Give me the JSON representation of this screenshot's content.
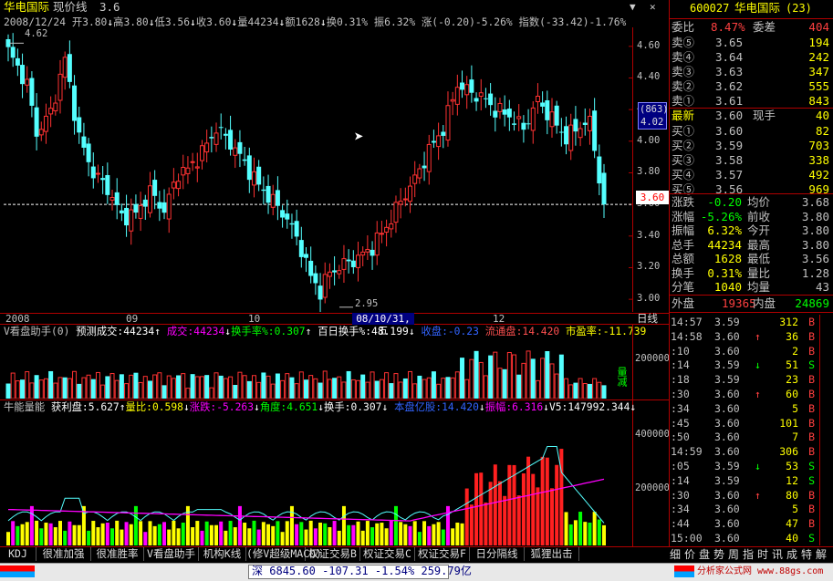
{
  "header": {
    "name": "华电国际",
    "label": "现价线",
    "price": "3.6"
  },
  "quote_line": {
    "date": "2008/12/24",
    "open_label": "开",
    "open": "3.80",
    "high_label": "高",
    "high": "3.80",
    "low_label": "低",
    "low": "3.56",
    "close_label": "收",
    "close": "3.60",
    "vol_label": "量",
    "vol": "44234",
    "amt_label": "额",
    "amt": "1628",
    "turn_label": "换",
    "turn": "0.31%",
    "amp_label": "振",
    "amp": "6.32%",
    "chg_label": "涨",
    "chg": "(-0.20)-5.26%",
    "idx_label": "指数",
    "idx": "(-33.42)-1.76%"
  },
  "main_chart": {
    "type": "candlestick",
    "y_ticks": [
      "4.60",
      "4.40",
      "4.20",
      "4.00",
      "3.80",
      "3.60",
      "3.40",
      "3.20",
      "3.00"
    ],
    "y_range": [
      2.92,
      4.72
    ],
    "current_price": "3.60",
    "crosshair": {
      "top": "(863)",
      "bottom": "4.02"
    },
    "max_label": "4.62",
    "min_label": "2.95",
    "colors": {
      "up": "#ff3232",
      "down": "#54ffff",
      "axis": "#b00000",
      "text": "#c0c0c0"
    }
  },
  "date_axis": {
    "labels": [
      "2008",
      "09",
      "10",
      "12"
    ],
    "highlight": "08/10/31,五",
    "right_label": "日线"
  },
  "vol_panel": {
    "title": "V看盘助手(0)",
    "f1_label": "预测成交:",
    "f1": "44234",
    "f2_label": "成交:",
    "f2": "44234",
    "f3_label": "换手率%:",
    "f3": "0.307",
    "f4_label": "百日换手%:",
    "f4": "48.199",
    "f5_label": "收盘:",
    "f5": "-0.23",
    "f6_label": "流通盘:",
    "f6": "14.420",
    "f7_label": "市盈率:",
    "f7": "-11.739",
    "y_ticks": [
      "200000"
    ],
    "side_label": "量减"
  },
  "energy_panel": {
    "title": "牛能量能",
    "f1_label": "获利盘:",
    "f1": "5.627",
    "f2_label": "量比:",
    "f2": "0.598",
    "f3_label": "涨跌:",
    "f3": "-5.263",
    "f4_label": "角度:",
    "f4": "4.651",
    "f5_label": "换手:",
    "f5": "0.307",
    "f6_label": "本盘亿股:",
    "f6": "14.420",
    "f7_label": "振幅:",
    "f7": "6.316",
    "f8_label": "V5:",
    "f8": "147992.344",
    "y_ticks": [
      "400000",
      "200000"
    ]
  },
  "tabs": [
    "KDJ",
    "很准加强",
    "很准胜率",
    "V看盘助手",
    "机构K线",
    "(修V超级MACD)",
    "权证交易B",
    "权证交易C",
    "权证交易F",
    "日分隔线",
    "狐狸出击"
  ],
  "status_bar": {
    "index_name": "深",
    "index_value": "6845.60",
    "change": "-107.31",
    "pct": "-1.54%",
    "amount": "259.79亿",
    "watermark": "分析家公式网 www.88gs.com"
  },
  "right_panel": {
    "code": "600027",
    "name": "华电国际",
    "num": "(23)",
    "weibi_label": "委比",
    "weibi": "8.47%",
    "weicha_label": "委差",
    "weicha": "404",
    "sells": [
      {
        "label": "卖⑤",
        "price": "3.65",
        "vol": "194"
      },
      {
        "label": "卖④",
        "price": "3.64",
        "vol": "242"
      },
      {
        "label": "卖③",
        "price": "3.63",
        "vol": "347"
      },
      {
        "label": "卖②",
        "price": "3.62",
        "vol": "555"
      },
      {
        "label": "卖①",
        "price": "3.61",
        "vol": "843"
      }
    ],
    "last_label": "最新",
    "last": "3.60",
    "xianshou_label": "现手",
    "xianshou": "40",
    "buys": [
      {
        "label": "买①",
        "price": "3.60",
        "vol": "82"
      },
      {
        "label": "买②",
        "price": "3.59",
        "vol": "703"
      },
      {
        "label": "买③",
        "price": "3.58",
        "vol": "338"
      },
      {
        "label": "买④",
        "price": "3.57",
        "vol": "492"
      },
      {
        "label": "买⑤",
        "price": "3.56",
        "vol": "969"
      }
    ],
    "stats": [
      {
        "l1": "涨跌",
        "v1": "-0.20",
        "l2": "均价",
        "v2": "3.68"
      },
      {
        "l1": "涨幅",
        "v1": "-5.26%",
        "l2": "前收",
        "v2": "3.80"
      },
      {
        "l1": "振幅",
        "v1": "6.32%",
        "l2": "今开",
        "v2": "3.80"
      },
      {
        "l1": "总手",
        "v1": "44234",
        "l2": "最高",
        "v2": "3.80"
      },
      {
        "l1": "总额",
        "v1": "1628",
        "l2": "最低",
        "v2": "3.56"
      },
      {
        "l1": "换手",
        "v1": "0.31%",
        "l2": "量比",
        "v2": "1.28"
      },
      {
        "l1": "分笔",
        "v1": "1040",
        "l2": "均量",
        "v2": "43"
      }
    ],
    "waipan_label": "外盘",
    "waipan": "19365",
    "neipan_label": "内盘",
    "neipan": "24869",
    "ticks": [
      {
        "time": "14:57",
        "price": "3.59",
        "arrow": "",
        "vol": "312",
        "bs": "B"
      },
      {
        "time": "14:58",
        "price": "3.60",
        "arrow": "↑",
        "vol": "36",
        "bs": "B"
      },
      {
        "time": ":10",
        "price": "3.60",
        "arrow": "",
        "vol": "2",
        "bs": "B"
      },
      {
        "time": ":14",
        "price": "3.59",
        "arrow": "↓",
        "vol": "51",
        "bs": "S"
      },
      {
        "time": ":18",
        "price": "3.59",
        "arrow": "",
        "vol": "23",
        "bs": "B"
      },
      {
        "time": ":30",
        "price": "3.60",
        "arrow": "↑",
        "vol": "60",
        "bs": "B"
      },
      {
        "time": ":34",
        "price": "3.60",
        "arrow": "",
        "vol": "5",
        "bs": "B"
      },
      {
        "time": ":45",
        "price": "3.60",
        "arrow": "",
        "vol": "101",
        "bs": "B"
      },
      {
        "time": ":50",
        "price": "3.60",
        "arrow": "",
        "vol": "7",
        "bs": "B"
      },
      {
        "time": "14:59",
        "price": "3.60",
        "arrow": "",
        "vol": "306",
        "bs": "B"
      },
      {
        "time": ":05",
        "price": "3.59",
        "arrow": "↓",
        "vol": "53",
        "bs": "S"
      },
      {
        "time": ":14",
        "price": "3.59",
        "arrow": "",
        "vol": "12",
        "bs": "S"
      },
      {
        "time": ":30",
        "price": "3.60",
        "arrow": "↑",
        "vol": "80",
        "bs": "B"
      },
      {
        "time": ":34",
        "price": "3.60",
        "arrow": "",
        "vol": "5",
        "bs": "B"
      },
      {
        "time": ":44",
        "price": "3.60",
        "arrow": "",
        "vol": "47",
        "bs": "B"
      },
      {
        "time": "15:00",
        "price": "3.60",
        "arrow": "",
        "vol": "40",
        "bs": "S"
      }
    ],
    "bottom_tabs": [
      "细",
      "价",
      "盘",
      "势",
      "周",
      "指",
      "时",
      "讯",
      "成",
      "特",
      "解"
    ]
  }
}
